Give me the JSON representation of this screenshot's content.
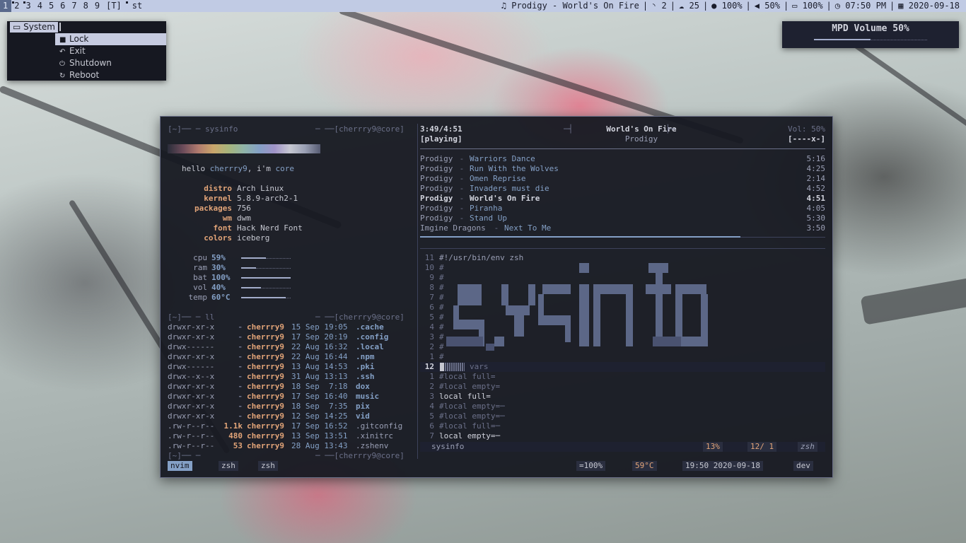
{
  "topbar": {
    "tags": [
      "1",
      "2",
      "3",
      "4",
      "5",
      "6",
      "7",
      "8",
      "9",
      "[T]"
    ],
    "window_title": "st",
    "status": {
      "music": "Prodigy - World's On Fire",
      "rss": "2",
      "cloud": "25",
      "brightness": "100%",
      "volume": "50%",
      "battery": "100%",
      "time": "07:50 PM",
      "date": "2020-09-18"
    }
  },
  "menu": {
    "title": "System",
    "items": [
      "Lock",
      "Exit",
      "Shutdown",
      "Reboot"
    ]
  },
  "volume_popup": {
    "label": "MPD Volume 50%",
    "level": 0.5
  },
  "sysinfo": {
    "header_left": "[~]── ─ sysinfo",
    "header_right": "─ ──[cherrry9@core]",
    "greeting_pre": "hello ",
    "greeting_user": "cherrry9",
    "greeting_mid": ", i'm ",
    "greeting_host": "core",
    "fields": [
      {
        "key": "distro",
        "value": "Arch Linux"
      },
      {
        "key": "kernel",
        "value": "5.8.9-arch2-1"
      },
      {
        "key": "packages",
        "value": "756"
      },
      {
        "key": "wm",
        "value": "dwm"
      },
      {
        "key": "font",
        "value": "Hack Nerd Font"
      },
      {
        "key": "colors",
        "value": "iceberg"
      }
    ],
    "bars": [
      {
        "key": "cpu",
        "value": "59%",
        "level": 0.5
      },
      {
        "key": "ram",
        "value": "30%",
        "level": 0.3
      },
      {
        "key": "bat",
        "value": "100%",
        "level": 1.0
      },
      {
        "key": "vol",
        "value": "40%",
        "level": 0.4
      },
      {
        "key": "temp",
        "value": "60°C",
        "level": 0.9
      }
    ]
  },
  "ll": {
    "header_left": "[~]── ─ ll",
    "header_right": "─ ──[cherrry9@core]",
    "rows": [
      {
        "perm": "drwxr-xr-x",
        "size": "-",
        "user": "cherrry9",
        "date": "15 Sep 19:05",
        "name": ".cache"
      },
      {
        "perm": "drwxr-xr-x",
        "size": "-",
        "user": "cherrry9",
        "date": "17 Sep 20:19",
        "name": ".config"
      },
      {
        "perm": "drwx------",
        "size": "-",
        "user": "cherrry9",
        "date": "22 Aug 16:32",
        "name": ".local"
      },
      {
        "perm": "drwxr-xr-x",
        "size": "-",
        "user": "cherrry9",
        "date": "22 Aug 16:44",
        "name": ".npm"
      },
      {
        "perm": "drwx------",
        "size": "-",
        "user": "cherrry9",
        "date": "13 Aug 14:53",
        "name": ".pki"
      },
      {
        "perm": "drwx--x--x",
        "size": "-",
        "user": "cherrry9",
        "date": "31 Aug 13:13",
        "name": ".ssh"
      },
      {
        "perm": "drwxr-xr-x",
        "size": "-",
        "user": "cherrry9",
        "date": "18 Sep  7:18",
        "name": "dox"
      },
      {
        "perm": "drwxr-xr-x",
        "size": "-",
        "user": "cherrry9",
        "date": "17 Sep 16:40",
        "name": "music"
      },
      {
        "perm": "drwxr-xr-x",
        "size": "-",
        "user": "cherrry9",
        "date": "18 Sep  7:35",
        "name": "pix"
      },
      {
        "perm": "drwxr-xr-x",
        "size": "-",
        "user": "cherrry9",
        "date": "12 Sep 14:25",
        "name": "vid"
      },
      {
        "perm": ".rw-r--r--",
        "size": "1.1k",
        "user": "cherrry9",
        "date": "17 Sep 16:52",
        "name": ".gitconfig"
      },
      {
        "perm": ".rw-r--r--",
        "size": "480",
        "user": "cherrry9",
        "date": "13 Sep 13:51",
        "name": ".xinitrc"
      },
      {
        "perm": ".rw-r--r--",
        "size": "53",
        "user": "cherrry9",
        "date": "28 Aug 13:43",
        "name": ".zshenv"
      }
    ],
    "prompt_left": "[~]── ─",
    "prompt_right": "─ ──[cherrry9@core]"
  },
  "player": {
    "time": "3:49/4:51",
    "state": "[playing]",
    "song": "World's On Fire",
    "artist": "Prodigy",
    "volume": "Vol: 50%",
    "flags": "[----x-]",
    "progress": 0.79,
    "playlist": [
      {
        "artist": "Prodigy",
        "title": "Warriors Dance",
        "len": "5:16",
        "current": false
      },
      {
        "artist": "Prodigy",
        "title": "Run With the Wolves",
        "len": "4:25",
        "current": false
      },
      {
        "artist": "Prodigy",
        "title": "Omen Reprise",
        "len": "2:14",
        "current": false
      },
      {
        "artist": "Prodigy",
        "title": "Invaders must die",
        "len": "4:52",
        "current": false
      },
      {
        "artist": "Prodigy",
        "title": "World's On Fire",
        "len": "4:51",
        "current": true
      },
      {
        "artist": "Prodigy",
        "title": "Piranha",
        "len": "4:05",
        "current": false
      },
      {
        "artist": "Prodigy",
        "title": "Stand Up",
        "len": "5:30",
        "current": false
      },
      {
        "artist": "Imgine Dragons",
        "title": "Next To Me",
        "len": "3:50",
        "current": false
      }
    ]
  },
  "editor": {
    "shebang": "#!/usr/bin/env zsh",
    "relnums_above": [
      "11",
      "10",
      "9",
      "8",
      "7",
      "6",
      "5",
      "4",
      "3",
      "2",
      "1"
    ],
    "current_line": "12",
    "current_text": "vars",
    "relnums_below": [
      "1",
      "2",
      "3",
      "4",
      "5",
      "6",
      "7"
    ],
    "below_lines": [
      {
        "text": "#local full=",
        "comment": true
      },
      {
        "text": "#local empty=",
        "comment": true
      },
      {
        "text": "local full=",
        "comment": false
      },
      {
        "text": "#local empty=─",
        "comment": true
      },
      {
        "text": "#local empty=─",
        "comment": true
      },
      {
        "text": "#local full=─",
        "comment": true
      },
      {
        "text": "local empty=─",
        "comment": false
      }
    ],
    "status_file": "sysinfo",
    "status_percent": "13%",
    "status_pos": "12/ 1",
    "status_ft": "zsh"
  },
  "tmux": {
    "windows": [
      "nvim",
      "zsh",
      "zsh"
    ],
    "battery": "=100%",
    "temp": "59°C",
    "clock": "19:50 2020-09-18",
    "session": "dev"
  }
}
